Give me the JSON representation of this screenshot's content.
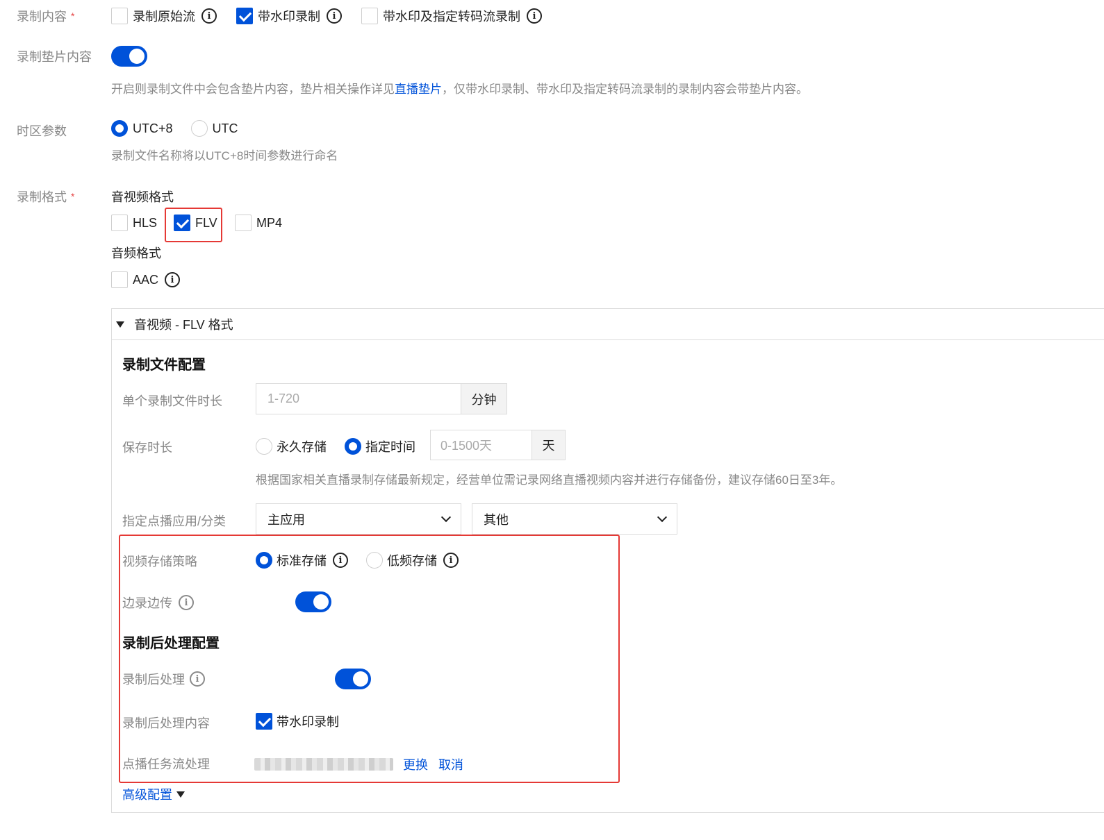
{
  "record_content": {
    "label": "录制内容",
    "required_mark": "*",
    "options": [
      {
        "label": "录制原始流",
        "checked": false
      },
      {
        "label": "带水印录制",
        "checked": true
      },
      {
        "label": "带水印及指定转码流录制",
        "checked": false
      }
    ]
  },
  "record_slate": {
    "label": "录制垫片内容",
    "enabled": true,
    "hint_before": "开启则录制文件中会包含垫片内容，垫片相关操作详见 ",
    "hint_link": "直播垫片",
    "hint_after": "，仅带水印录制、带水印及指定转码流录制的录制内容会带垫片内容。"
  },
  "timezone": {
    "label": "时区参数",
    "options": [
      {
        "label": "UTC+8",
        "selected": true
      },
      {
        "label": "UTC",
        "selected": false
      }
    ],
    "hint": "录制文件名称将以UTC+8时间参数进行命名"
  },
  "record_format": {
    "label": "录制格式",
    "required_mark": "*",
    "av_title": "音视频格式",
    "av_options": [
      {
        "label": "HLS",
        "checked": false
      },
      {
        "label": "FLV",
        "checked": true
      },
      {
        "label": "MP4",
        "checked": false
      }
    ],
    "audio_title": "音频格式",
    "audio_options": [
      {
        "label": "AAC",
        "checked": false
      }
    ]
  },
  "flv_panel": {
    "title": "音视频 - FLV 格式",
    "file_config_title": "录制文件配置",
    "duration_label": "单个录制文件时长",
    "duration_placeholder": "1-720",
    "duration_unit": "分钟",
    "retention_label": "保存时长",
    "retention_options": [
      {
        "label": "永久存储",
        "selected": false
      },
      {
        "label": "指定时间",
        "selected": true
      }
    ],
    "retention_placeholder": "0-1500天",
    "retention_unit": "天",
    "retention_hint": "根据国家相关直播录制存储最新规定，经营单位需记录网络直播视频内容并进行存储备份，建议存储60日至3年。",
    "vod_app_label": "指定点播应用/分类",
    "vod_app_value": "主应用",
    "vod_category_value": "其他",
    "storage_policy_label": "视频存储策略",
    "storage_options": [
      {
        "label": "标准存储",
        "selected": true
      },
      {
        "label": "低频存储",
        "selected": false
      }
    ],
    "record_upload_label": "边录边传",
    "record_upload_enabled": true,
    "post_title": "录制后处理配置",
    "post_process_label": "录制后处理",
    "post_process_enabled": true,
    "post_content_label": "录制后处理内容",
    "post_content_option": "带水印录制",
    "post_content_checked": true,
    "vod_task_label": "点播任务流处理",
    "change_link": "更换",
    "cancel_link": "取消",
    "advanced_link": "高级配置"
  },
  "colors": {
    "primary": "#0052d9",
    "highlight_border": "#e53935",
    "required": "#e54545"
  }
}
